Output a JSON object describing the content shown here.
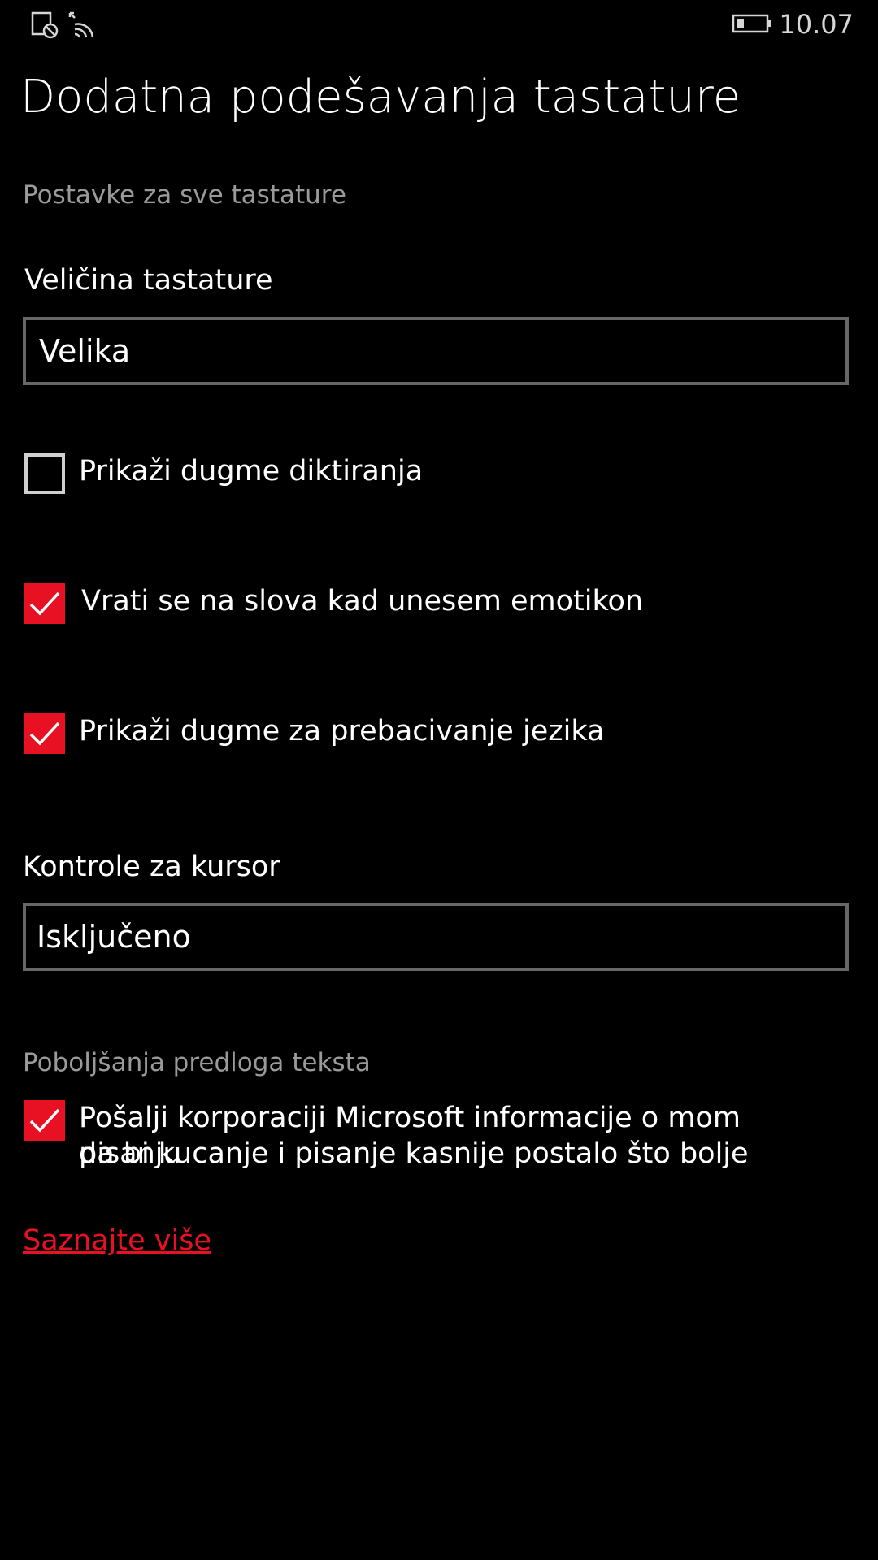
{
  "status_bar": {
    "icons": [
      "notification-icon",
      "wifi-icon",
      "battery-icon"
    ],
    "time": "10.07"
  },
  "page": {
    "title": "Dodatna podešavanja tastature"
  },
  "sections": {
    "all_keyboards": "Postavke za sve tastature",
    "text_suggestions": "Poboljšanja predloga teksta"
  },
  "keyboard_size": {
    "label": "Veličina tastature",
    "value": "Velika"
  },
  "checkboxes": [
    {
      "label": "Prikaži dugme diktiranja",
      "checked": false
    },
    {
      "label": "Vrati se na slova kad unesem emotikon",
      "checked": true
    },
    {
      "label": "Prikaži dugme za prebacivanje jezika",
      "checked": true
    }
  ],
  "cursor_controls": {
    "label": "Kontrole za kursor",
    "value": "Isključeno"
  },
  "send_info": {
    "label_line1": "Pošalji korporaciji Microsoft informacije o mom pisanju",
    "label_line2": "da bi kucanje i pisanje kasnije postalo što bolje",
    "checked": true
  },
  "learn_more": "Saznajte više",
  "colors": {
    "accent": "#e81123",
    "background": "#000000",
    "border": "#676767",
    "secondary_text": "#9a9a9a"
  }
}
